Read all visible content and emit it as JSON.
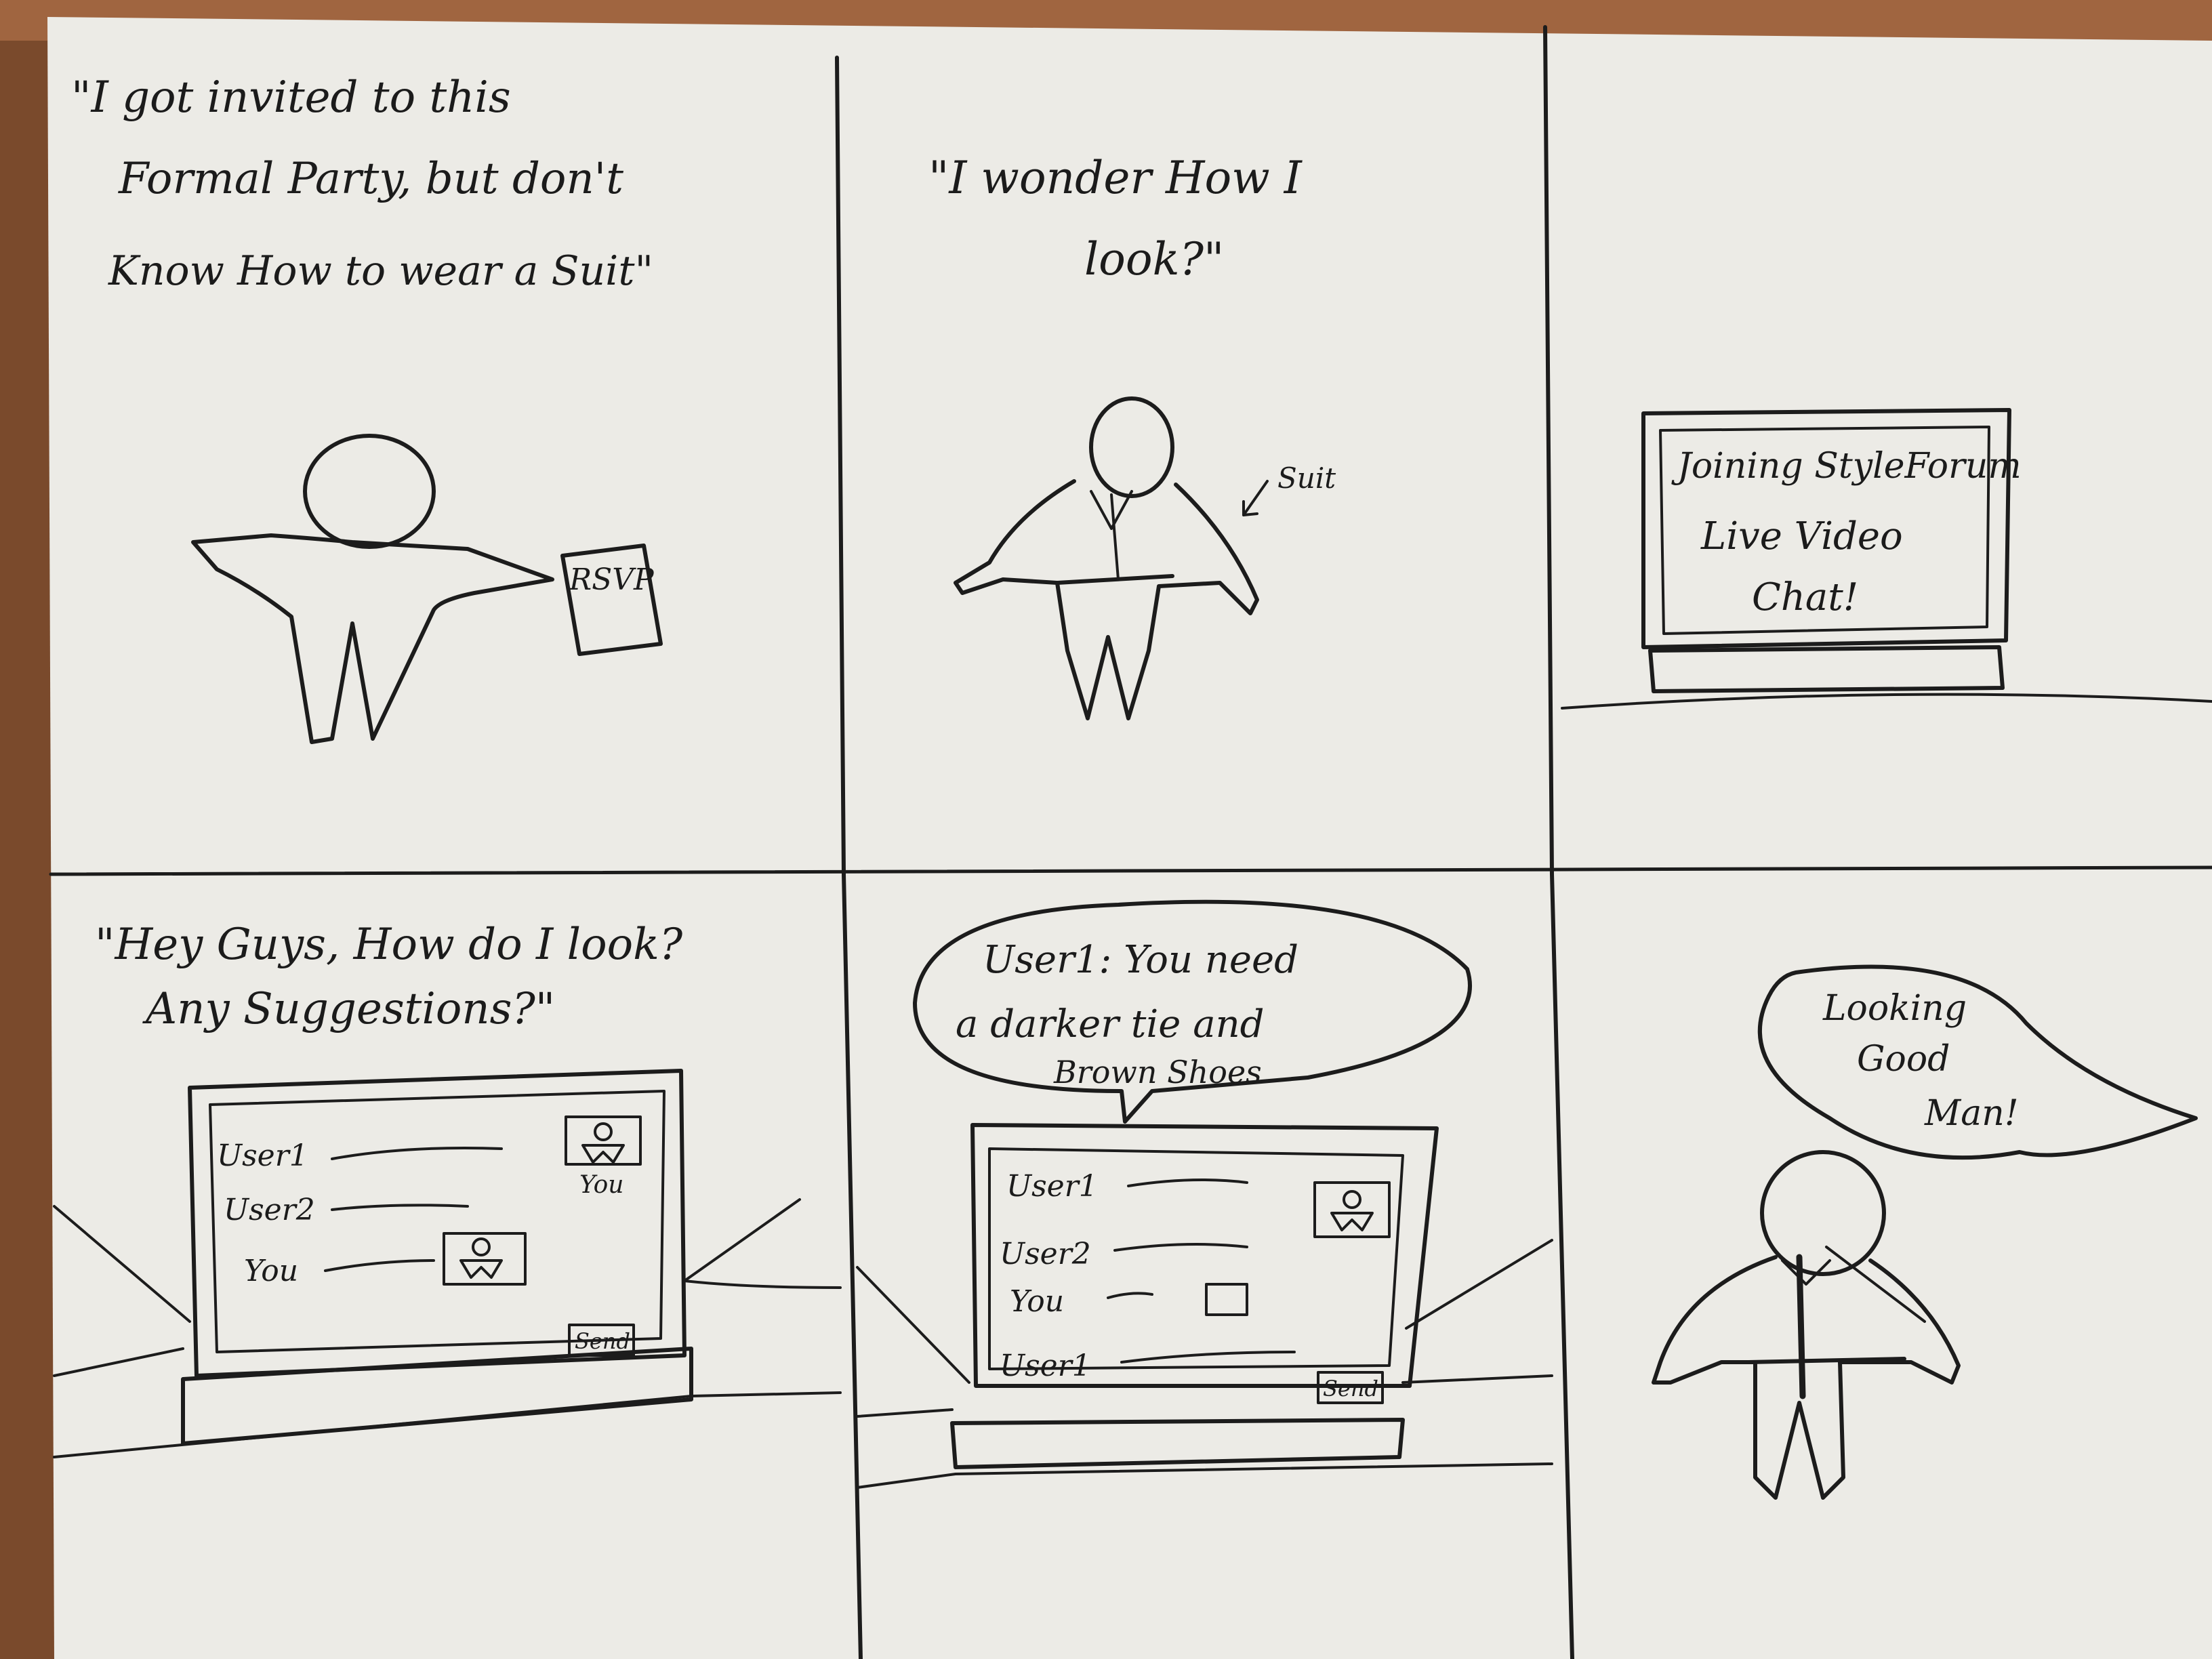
{
  "panels": [
    {
      "id": 1,
      "caption_lines": [
        "\"I got invited to this",
        "Formal Party, but  don't",
        "Know How to wear a Suit\""
      ],
      "rsvp_label": "RSVP"
    },
    {
      "id": 2,
      "caption_lines": [
        "\"I wonder How I",
        "look?\""
      ],
      "suit_label": "Suit"
    },
    {
      "id": 3,
      "screen_lines": [
        "Joining StyleForum",
        "Live Video",
        "Chat!"
      ]
    },
    {
      "id": 4,
      "caption_lines": [
        "\"Hey Guys, How do I look?",
        "Any Suggestions?\""
      ],
      "chat_names": [
        "User1",
        "User2",
        "You"
      ],
      "video_label": "You",
      "send_label": "Send"
    },
    {
      "id": 5,
      "bubble_lines": [
        "User1: You need",
        "a darker tie and",
        "Brown Shoes"
      ],
      "chat_names": [
        "User1",
        "User2",
        "You",
        "User1"
      ],
      "send_label": "Send"
    },
    {
      "id": 6,
      "bubble_lines": [
        "Looking",
        "Good",
        "Man!"
      ]
    }
  ]
}
